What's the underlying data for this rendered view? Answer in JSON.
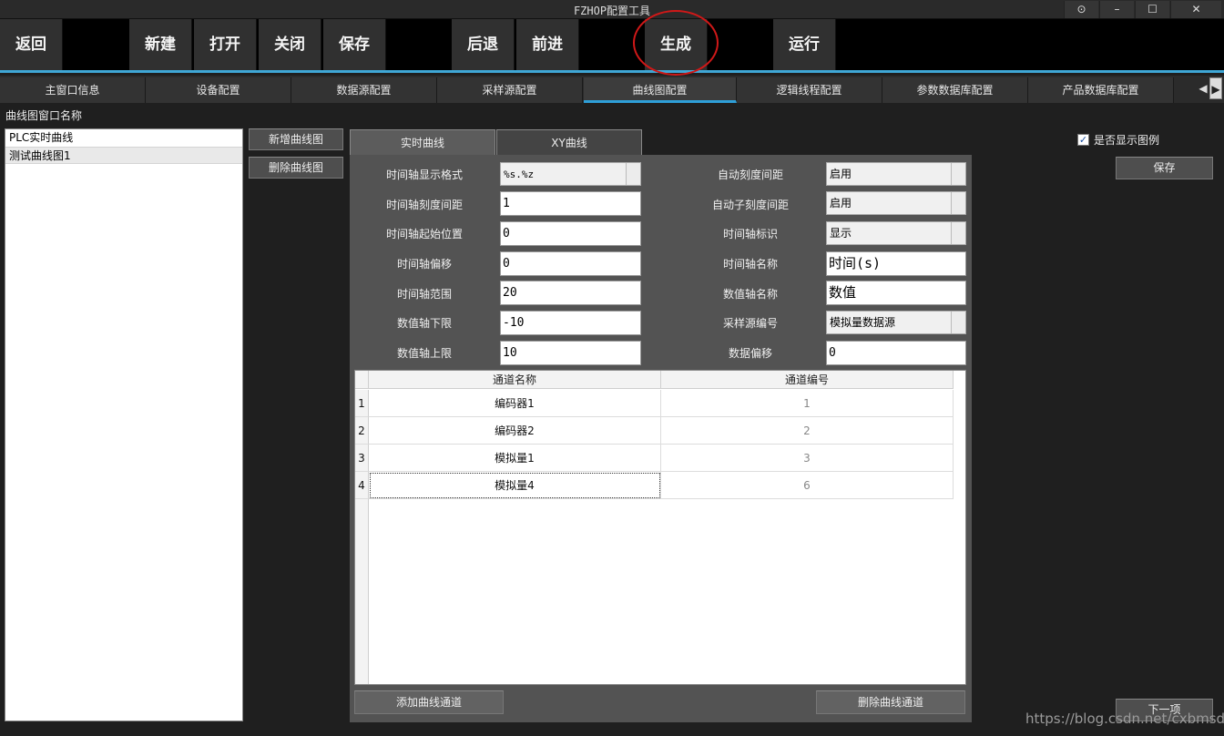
{
  "window": {
    "title": "FZHOP配置工具",
    "controls": [
      "⊙",
      "–",
      "☐",
      "✕"
    ]
  },
  "toolbar": {
    "back": "返回",
    "new": "新建",
    "open": "打开",
    "close": "关闭",
    "save": "保存",
    "undo": "后退",
    "redo": "前进",
    "generate": "生成",
    "run": "运行"
  },
  "tabs": [
    "主窗口信息",
    "设备配置",
    "数据源配置",
    "采样源配置",
    "曲线图配置",
    "逻辑线程配置",
    "参数数据库配置",
    "产品数据库配置"
  ],
  "active_tab": "曲线图配置",
  "left": {
    "section_label": "曲线图窗口名称",
    "items": [
      "PLC实时曲线",
      "测试曲线图1"
    ],
    "selected": "测试曲线图1",
    "add_button": "新增曲线图",
    "delete_button": "删除曲线图"
  },
  "inner_tabs": [
    "实时曲线",
    "XY曲线"
  ],
  "form": {
    "time_format_label": "时间轴显示格式",
    "time_format_value": "%s.%z",
    "time_tick_label": "时间轴刻度间距",
    "time_tick_value": "1",
    "time_start_label": "时间轴起始位置",
    "time_start_value": "0",
    "time_offset_label": "时间轴偏移",
    "time_offset_value": "0",
    "time_range_label": "时间轴范围",
    "time_range_value": "20",
    "value_min_label": "数值轴下限",
    "value_min_value": "-10",
    "value_max_label": "数值轴上限",
    "value_max_value": "10",
    "auto_tick_label": "自动刻度间距",
    "auto_tick_value": "启用",
    "auto_subtick_label": "自动子刻度间距",
    "auto_subtick_value": "启用",
    "time_marker_label": "时间轴标识",
    "time_marker_value": "显示",
    "time_name_label": "时间轴名称",
    "time_name_value": "时间(s)",
    "value_name_label": "数值轴名称",
    "value_name_value": "数值",
    "sample_src_label": "采样源编号",
    "sample_src_value": "模拟量数据源",
    "data_offset_label": "数据偏移",
    "data_offset_value": "0"
  },
  "table": {
    "headers": [
      "通道名称",
      "通道编号"
    ],
    "rows": [
      {
        "idx": "1",
        "name": "编码器1",
        "num": "1"
      },
      {
        "idx": "2",
        "name": "编码器2",
        "num": "2"
      },
      {
        "idx": "3",
        "name": "模拟量1",
        "num": "3"
      },
      {
        "idx": "4",
        "name": "模拟量4",
        "num": "6"
      }
    ]
  },
  "bottom": {
    "add_channel": "添加曲线通道",
    "delete_channel": "删除曲线通道",
    "next": "下一项"
  },
  "right": {
    "show_legend_label": "是否显示图例",
    "show_legend_checked": true,
    "save_button": "保存"
  },
  "watermark": "https://blog.csdn.net/cxbmsdn",
  "colors": {
    "accent": "#3fa7d6",
    "highlight_ellipse": "#d01818"
  }
}
